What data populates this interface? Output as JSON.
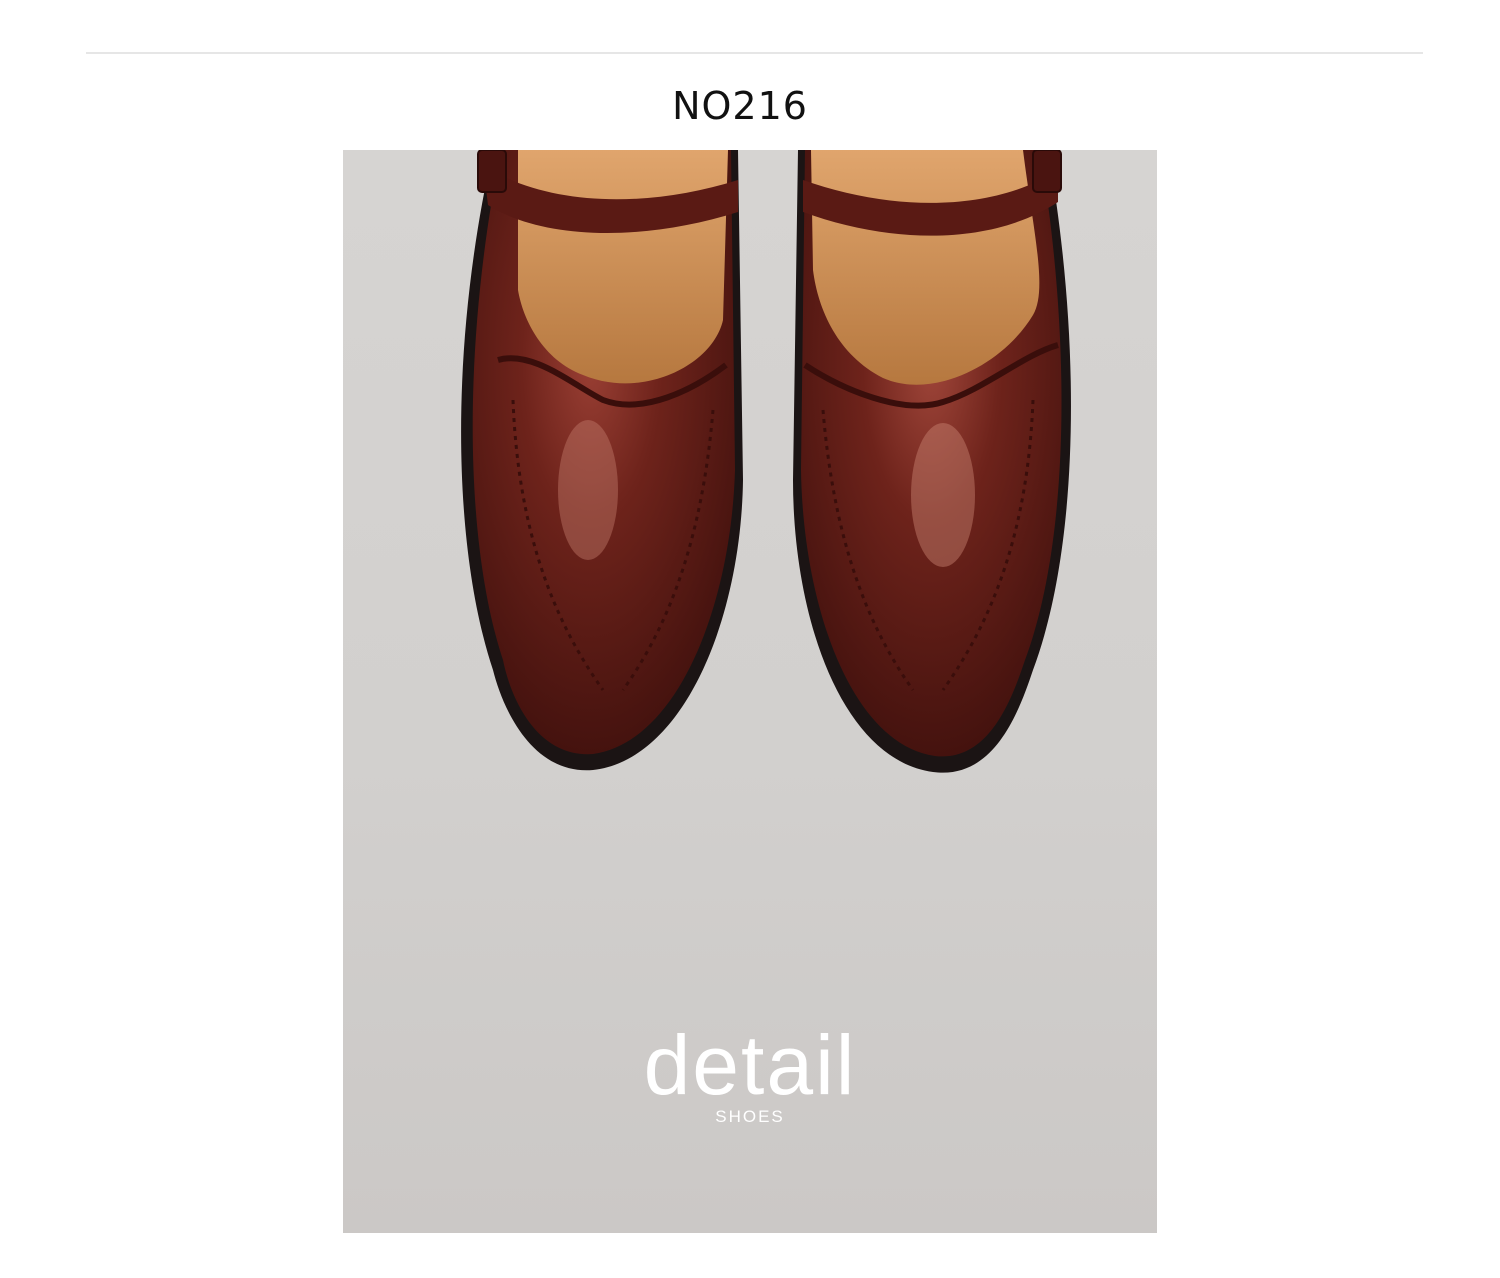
{
  "product": {
    "code": "NO216"
  },
  "photo": {
    "subject": "shoe-photo",
    "caption_title": "detail",
    "caption_subtitle": "SHOES"
  },
  "colors": {
    "page_background": "#ffffff",
    "divider": "#e6e6e6",
    "photo_background": "#d3d1cf",
    "leather": "#5a1a14",
    "lining": "#c98c55",
    "sole": "#1b1414",
    "caption": "#ffffff"
  }
}
